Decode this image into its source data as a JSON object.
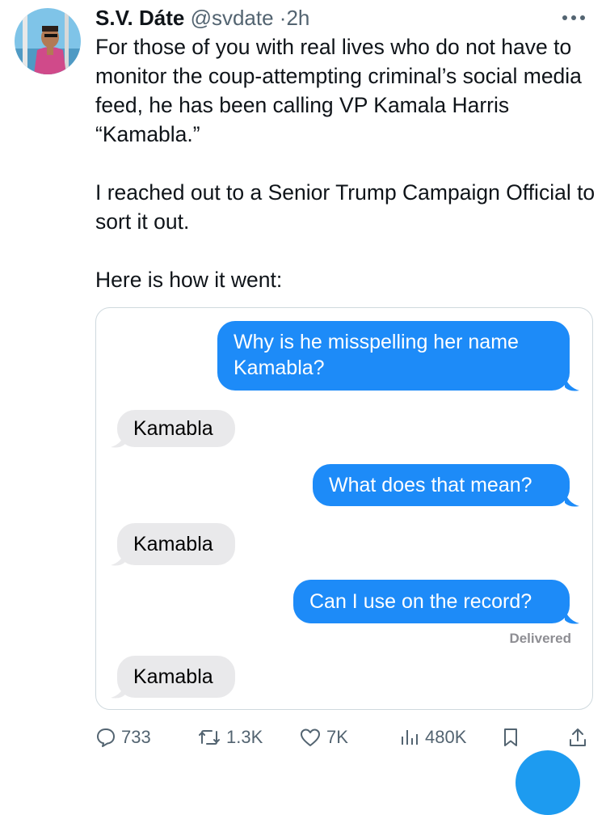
{
  "tweet": {
    "author_name": "S.V. Dáte",
    "handle": "@svdate",
    "separator": "·",
    "time": "2h",
    "text_paragraphs": [
      "For those of you with real lives who do not have to monitor the coup-attempting criminal’s social media feed, he has been calling VP Kamala Harris “Kamabla.”",
      "I reached out to a Senior Trump Campaign Official to sort it out.",
      "Here is how it went:"
    ]
  },
  "conversation": {
    "messages": [
      {
        "direction": "sent",
        "text": "Why is he misspelling her name Kamabla?"
      },
      {
        "direction": "received",
        "text": "Kamabla"
      },
      {
        "direction": "sent",
        "text": "What does that mean?"
      },
      {
        "direction": "received",
        "text": "Kamabla"
      },
      {
        "direction": "sent",
        "text": "Can I use on the record?"
      },
      {
        "direction": "received",
        "text": "Kamabla"
      }
    ],
    "status": "Delivered"
  },
  "actions": {
    "replies": "733",
    "retweets": "1.3K",
    "likes": "7K",
    "views": "480K"
  },
  "colors": {
    "sent_bubble": "#1d8bf8",
    "received_bubble": "#e9e9eb",
    "secondary_text": "#536471",
    "accent": "#1d9bf0"
  },
  "icons": [
    "more-icon",
    "reply-icon",
    "retweet-icon",
    "like-icon",
    "views-icon",
    "bookmark-icon",
    "share-icon"
  ]
}
